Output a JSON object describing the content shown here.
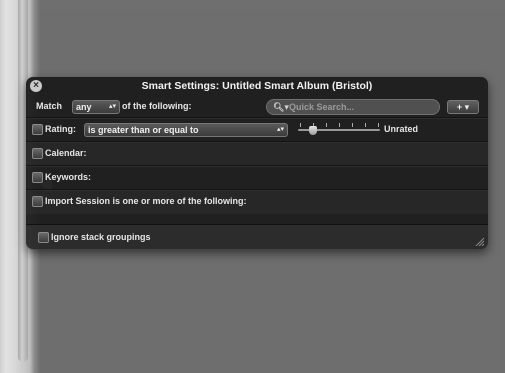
{
  "window": {
    "title": "Smart Settings: Untitled Smart Album (Bristol)"
  },
  "match": {
    "prefix": "Match",
    "mode": "any",
    "suffix": "of the following:"
  },
  "search": {
    "placeholder": "Quick Search..."
  },
  "add_button": {
    "label": "+ ▾"
  },
  "rules": [
    {
      "label": "Rating:",
      "operator": "is greater than or equal to",
      "value": "Unrated",
      "checked": false
    },
    {
      "label": "Calendar:",
      "checked": false
    },
    {
      "label": "Keywords:",
      "checked": false
    },
    {
      "label": "Import Session is one or more of the following:",
      "checked": false
    }
  ],
  "footer": {
    "ignore_stack_label": "Ignore stack groupings"
  },
  "icons": {
    "close": "close-icon",
    "search": "magnifier-icon",
    "add": "plus-icon",
    "resize": "resize-grip-icon"
  },
  "colors": {
    "hud_background": "#1c1c1c",
    "workspace_background": "#6f6f6f",
    "text": "#e8e8e8"
  }
}
